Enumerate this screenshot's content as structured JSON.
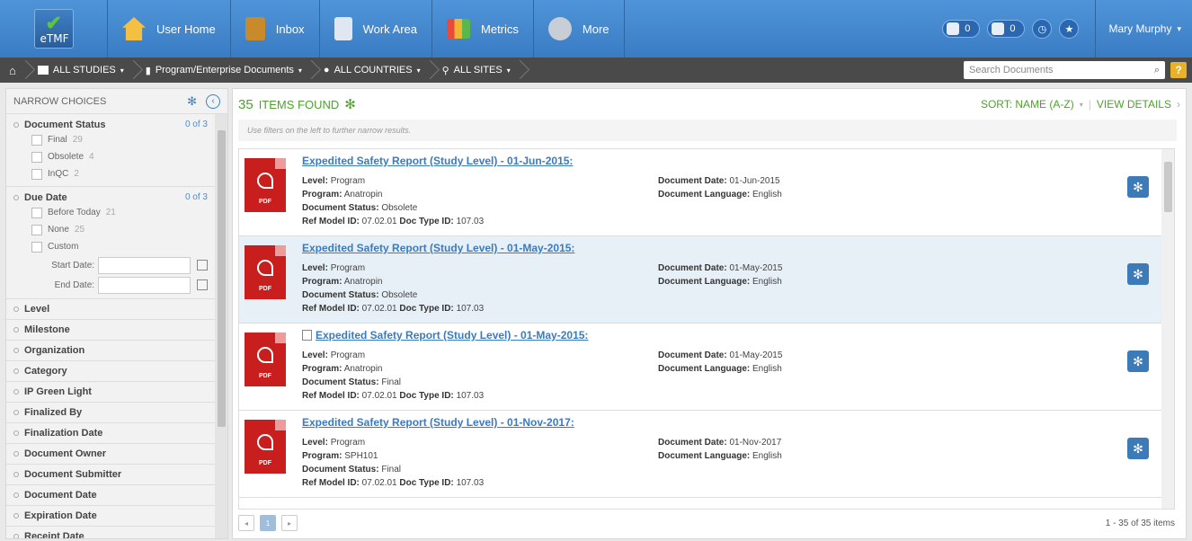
{
  "app": {
    "logo_text": "eTMF"
  },
  "nav": {
    "items": [
      {
        "label": "User Home",
        "icon": "home-icon"
      },
      {
        "label": "Inbox",
        "icon": "inbox-icon"
      },
      {
        "label": "Work Area",
        "icon": "document-icon"
      },
      {
        "label": "Metrics",
        "icon": "bar-chart-icon"
      },
      {
        "label": "More",
        "icon": "gear-icon"
      }
    ],
    "badges": [
      {
        "value": "0",
        "icon": "tray-icon"
      },
      {
        "value": "0",
        "icon": "tray-icon"
      }
    ],
    "user": "Mary Murphy"
  },
  "breadcrumb": {
    "items": [
      "ALL STUDIES",
      "Program/Enterprise Documents",
      "ALL COUNTRIES",
      "ALL SITES"
    ],
    "search_placeholder": "Search Documents",
    "help": "?"
  },
  "sidebar": {
    "title": "NARROW CHOICES",
    "document_status": {
      "label": "Document Status",
      "count": "0 of 3",
      "options": [
        {
          "label": "Final",
          "n": "29"
        },
        {
          "label": "Obsolete",
          "n": "4"
        },
        {
          "label": "InQC",
          "n": "2"
        }
      ]
    },
    "due_date": {
      "label": "Due Date",
      "count": "0 of 3",
      "options": [
        {
          "label": "Before Today",
          "n": "21"
        },
        {
          "label": "None",
          "n": "25"
        },
        {
          "label": "Custom",
          "n": ""
        }
      ],
      "start_label": "Start Date:",
      "end_label": "End Date:"
    },
    "facets": [
      "Level",
      "Milestone",
      "Organization",
      "Category",
      "IP Green Light",
      "Finalized By",
      "Finalization Date",
      "Document Owner",
      "Document Submitter",
      "Document Date",
      "Expiration Date",
      "Receipt Date"
    ]
  },
  "main": {
    "found_count": "35",
    "found_label": "ITEMS FOUND",
    "sort_label": "SORT: NAME (A-Z)",
    "view_details": "VIEW DETAILS",
    "hint": "Use filters on the left to further narrow results.",
    "pdf_label": "PDF",
    "rows": [
      {
        "title": "Expedited Safety Report (Study Level) - 01-Jun-2015:",
        "level": "Program",
        "program": "Anatropin",
        "status": "Obsolete",
        "ref_model": "07.02.01",
        "doc_type": "107.03",
        "doc_date": "01-Jun-2015",
        "language": "English",
        "copy": false,
        "selected": false
      },
      {
        "title": "Expedited Safety Report (Study Level) - 01-May-2015:",
        "level": "Program",
        "program": "Anatropin",
        "status": "Obsolete",
        "ref_model": "07.02.01",
        "doc_type": "107.03",
        "doc_date": "01-May-2015",
        "language": "English",
        "copy": false,
        "selected": true
      },
      {
        "title": "Expedited Safety Report (Study Level) - 01-May-2015:",
        "level": "Program",
        "program": "Anatropin",
        "status": "Final",
        "ref_model": "07.02.01",
        "doc_type": "107.03",
        "doc_date": "01-May-2015",
        "language": "English",
        "copy": true,
        "selected": false
      },
      {
        "title": "Expedited Safety Report (Study Level) - 01-Nov-2017:",
        "level": "Program",
        "program": "SPH101",
        "status": "Final",
        "ref_model": "07.02.01",
        "doc_type": "107.03",
        "doc_date": "01-Nov-2017",
        "language": "English",
        "copy": false,
        "selected": false
      }
    ],
    "labels": {
      "level": "Level:",
      "program": "Program:",
      "status": "Document Status:",
      "ref_model": "Ref Model ID:",
      "doc_type": "Doc Type ID:",
      "doc_date": "Document Date:",
      "language": "Document Language:"
    },
    "pager": {
      "current": "1",
      "summary": "1 - 35 of 35 items"
    }
  }
}
